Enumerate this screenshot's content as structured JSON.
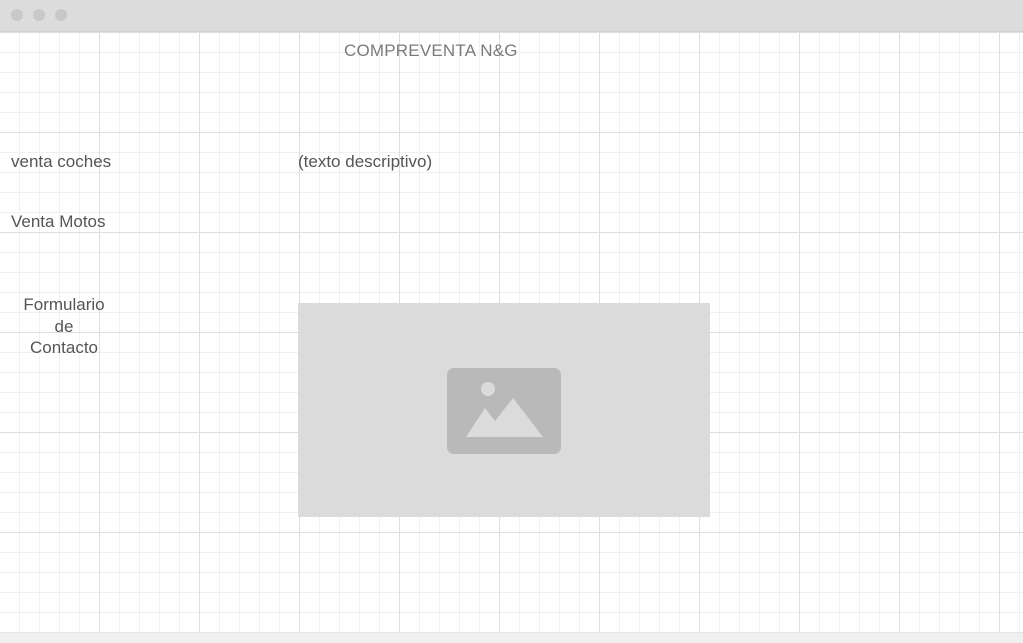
{
  "window": {
    "controls": [
      "close",
      "minimize",
      "maximize"
    ]
  },
  "header": {
    "title": "COMPREVENTA N&G"
  },
  "nav": {
    "items": [
      {
        "label": "venta coches"
      },
      {
        "label": "Venta Motos"
      },
      {
        "label": "Formulario\nde\nContacto"
      }
    ]
  },
  "main": {
    "description": "(texto descriptivo)",
    "image": {
      "icon": "image-icon"
    }
  },
  "colors": {
    "titlebar": "#dcdcdc",
    "placeholder": "#dbdbdb",
    "placeholder_icon": "#b9b9b9",
    "text": "#555555",
    "title_text": "#7a7a7a"
  }
}
